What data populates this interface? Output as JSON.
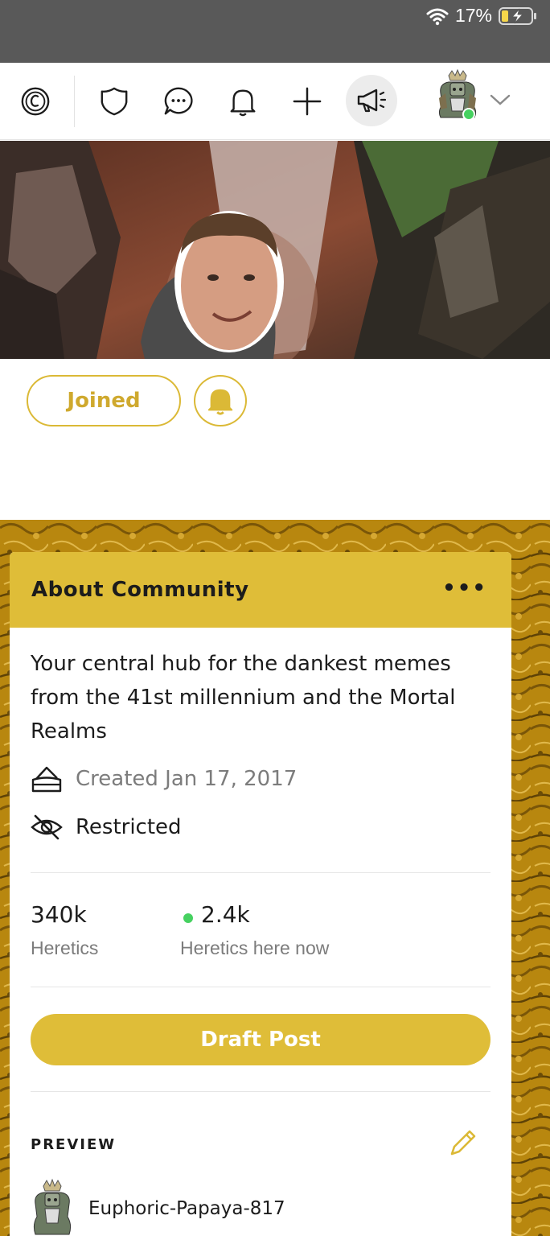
{
  "status_bar": {
    "battery_percent": "17%",
    "battery_level": 0.17,
    "charging": true
  },
  "nav": {
    "icons": [
      "coin-icon",
      "shield-icon",
      "chat-icon",
      "bell-icon",
      "plus-icon",
      "megaphone-icon",
      "avatar",
      "chevron-down-icon"
    ]
  },
  "community": {
    "joined_label": "Joined",
    "about": {
      "title": "About Community",
      "more": "•••",
      "description": "Your central hub for the dankest memes from the 41st millennium and the Mortal Realms",
      "created": "Created Jan 17, 2017",
      "status": "Restricted",
      "members_count": "340k",
      "members_label": "Heretics",
      "online_count": "2.4k",
      "online_label": "Heretics here now",
      "draft_button": "Draft Post",
      "preview_label": "PREVIEW",
      "preview_user": "Euphoric-Papaya-817"
    }
  },
  "colors": {
    "accent": "#dfbd38",
    "accent_text": "#cfa92e",
    "online": "#46d160",
    "status_bar": "#595959",
    "texture": "#b98a14"
  }
}
